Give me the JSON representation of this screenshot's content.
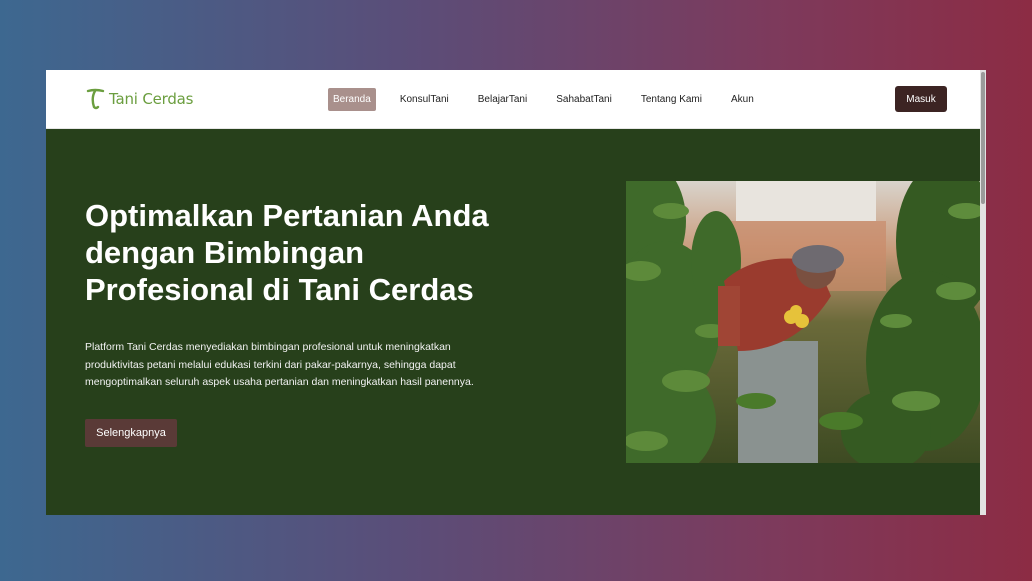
{
  "brand": {
    "name": "Tani Cerdas",
    "accent_color": "#6b9e3f"
  },
  "nav": {
    "items": [
      {
        "label": "Beranda",
        "active": true
      },
      {
        "label": "KonsulTani",
        "active": false
      },
      {
        "label": "BelajarTani",
        "active": false
      },
      {
        "label": "SahabatTani",
        "active": false
      },
      {
        "label": "Tentang Kami",
        "active": false
      },
      {
        "label": "Akun",
        "active": false
      }
    ],
    "login_label": "Masuk"
  },
  "hero": {
    "title": "Optimalkan Pertanian Anda dengan Bimbingan Profesional di Tani Cerdas",
    "description": "Platform Tani Cerdas menyediakan bimbingan profesional untuk meningkatkan produktivitas petani melalui edukasi terkini dari pakar-pakarnya, sehingga dapat mengoptimalkan seluruh aspek usaha pertanian dan meningkatkan hasil panennya.",
    "cta_label": "Selengkapnya",
    "background_color": "#27401b",
    "image_icon": "farmer-greenhouse-photo"
  }
}
